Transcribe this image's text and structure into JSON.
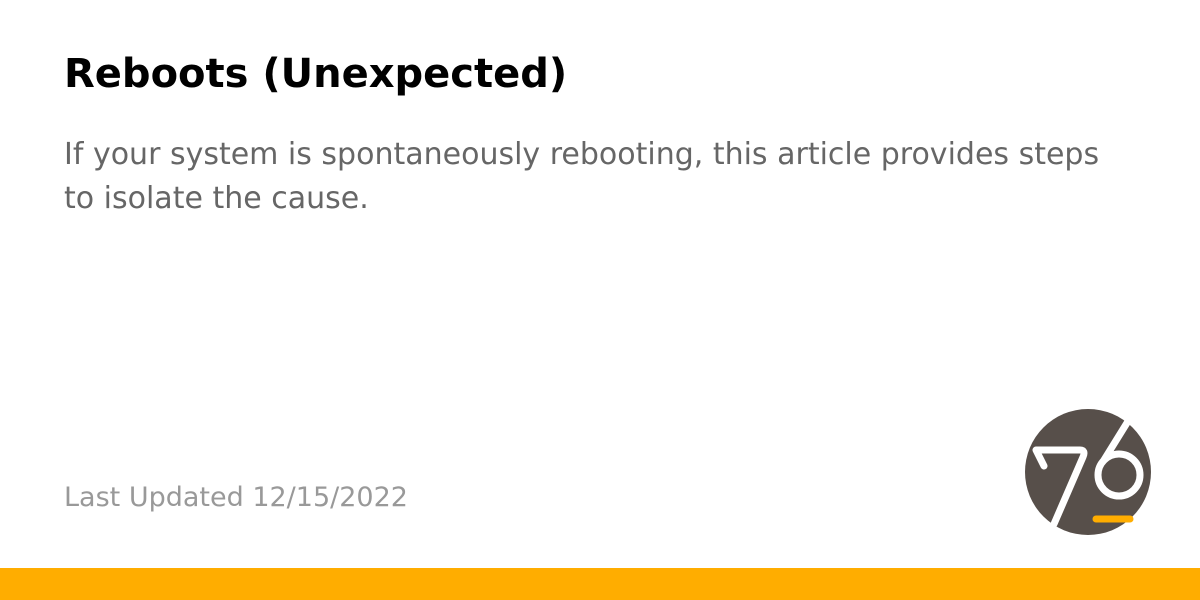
{
  "article": {
    "title": "Reboots (Unexpected)",
    "description": "If your system is spontaneously rebooting, this article provides steps to isolate the cause.",
    "last_updated": "Last Updated 12/15/2022"
  },
  "logo": {
    "icon": "system76-logo-icon",
    "background_color": "#574f4a",
    "mark_color": "#ffffff",
    "accent_color": "#ffad00"
  },
  "theme": {
    "accent_bar_color": "#ffad00",
    "title_color": "#000000",
    "description_color": "#666666",
    "meta_color": "#999999"
  }
}
